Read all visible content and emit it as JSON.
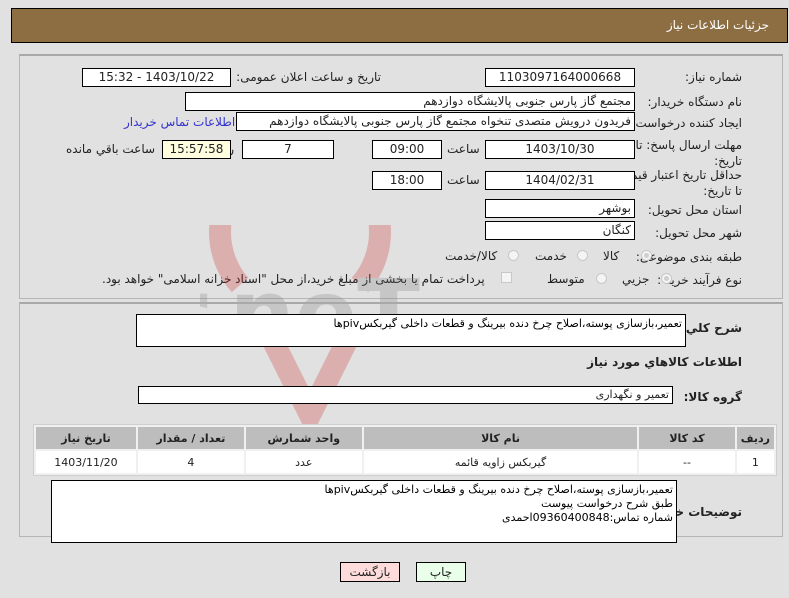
{
  "header": {
    "title": "جزئیات اطلاعات نیاز"
  },
  "fields": {
    "need_number": {
      "label": "شماره نیاز:",
      "value": "1103097164000668"
    },
    "announce_datetime": {
      "label": "تاریخ و ساعت اعلان عمومی:",
      "value": "1403/10/22 - 15:32"
    },
    "buyer_org": {
      "label": "نام دستگاه خریدار:",
      "value": "مجتمع گاز پارس جنوبی  پالایشگاه دوازدهم"
    },
    "requester": {
      "label": "ایجاد کننده درخواست:",
      "value": "فریدون درویش متصدی تنخواه مجتمع گاز پارس جنوبی  پالایشگاه دوازدهم"
    },
    "buyer_contact_link": "اطلاعات تماس خریدار",
    "reply_deadline": {
      "label": "مهلت ارسال پاسخ: تا تاریخ:",
      "date": "1403/10/30",
      "time_label": "ساعت",
      "time": "09:00",
      "days": "7",
      "days_label": "روز و",
      "remaining": "15:57:58",
      "remaining_label": "ساعت باقي مانده"
    },
    "price_validity": {
      "label": "حداقل تاریخ اعتبار قیمت: تا تاریخ:",
      "date": "1404/02/31",
      "time_label": "ساعت",
      "time": "18:00"
    },
    "province": {
      "label": "استان محل تحویل:",
      "value": "بوشهر"
    },
    "city": {
      "label": "شهر محل تحویل:",
      "value": "کنگان"
    },
    "category": {
      "label": "طبقه بندی موضوعی:",
      "options": [
        "کالا",
        "خدمت",
        "کالا/خدمت"
      ],
      "selected": "کالا"
    },
    "purchase_type": {
      "label": "نوع فرآیند خرید :",
      "options": [
        "جزیي",
        "متوسط"
      ],
      "selected": "جزیي",
      "payment_note": "پرداخت تمام یا بخشی از مبلغ خرید،از محل \"اسناد خزانه اسلامی\" خواهد بود."
    }
  },
  "description": {
    "label": "شرح کلي نیاز:",
    "value": "تعمیر،بازسازی پوسته،اصلاح چرخ دنده بیرینگ و قطعات داخلی گیربکسpivها"
  },
  "goods_section_title": "اطلاعات کالاهاي مورد نیاز",
  "goods_group": {
    "label": "گروه کالا:",
    "value": "تعمیر و نگهداری"
  },
  "items_table": {
    "headers": [
      "ردیف",
      "کد کالا",
      "نام کالا",
      "واحد شمارش",
      "تعداد / مقدار",
      "تاریخ نیاز"
    ],
    "rows": [
      [
        "1",
        "--",
        "گیربکس زاویه قائمه",
        "عدد",
        "4",
        "1403/11/20"
      ]
    ]
  },
  "buyer_notes": {
    "label": "توضیحات خریدار:",
    "value": "تعمیر،بازسازی پوسته،اصلاح چرخ دنده بیرینگ و قطعات داخلی گیربکسpivها\nطبق شرح درخواست پیوست\nشماره تماس:09360400848احمدی"
  },
  "buttons": {
    "print": "چاپ",
    "back": "بازگشت"
  },
  "watermark": "AriaTender.neT"
}
